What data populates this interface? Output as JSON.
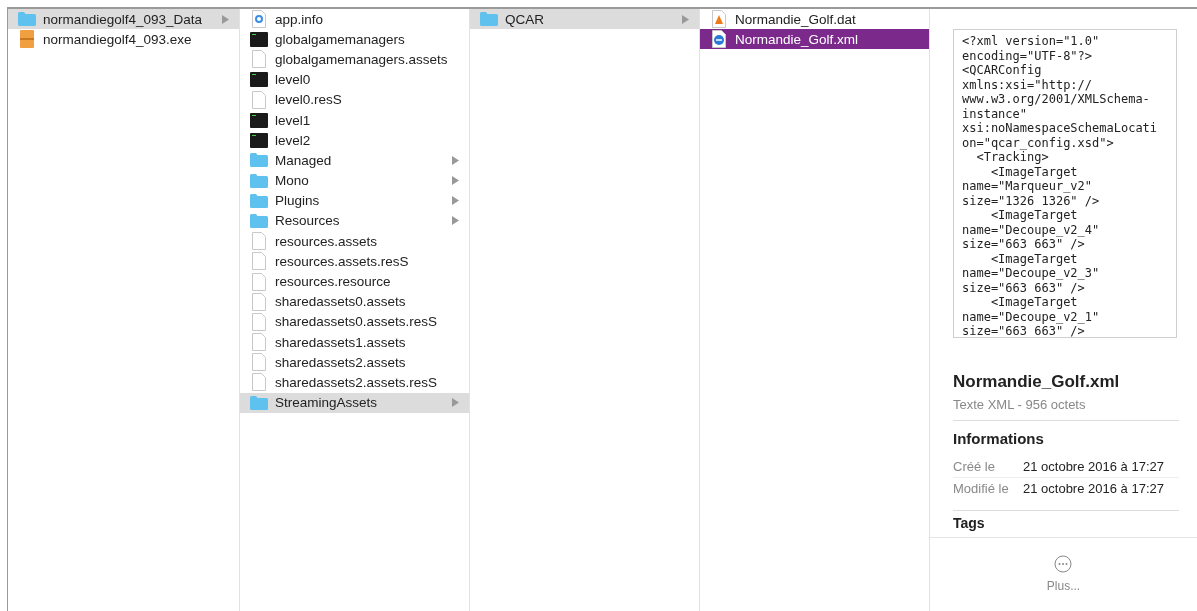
{
  "columns": [
    {
      "focused": false,
      "items": [
        {
          "name": "normandiegolf4_093_Data",
          "kind": "folder",
          "selected": true
        },
        {
          "name": "normandiegolf4_093.exe",
          "kind": "exe",
          "selected": false
        }
      ]
    },
    {
      "focused": false,
      "items": [
        {
          "name": "app.info",
          "kind": "info",
          "selected": false
        },
        {
          "name": "globalgamemanagers",
          "kind": "binary",
          "selected": false
        },
        {
          "name": "globalgamemanagers.assets",
          "kind": "file",
          "selected": false
        },
        {
          "name": "level0",
          "kind": "binary",
          "selected": false
        },
        {
          "name": "level0.resS",
          "kind": "file",
          "selected": false
        },
        {
          "name": "level1",
          "kind": "binary",
          "selected": false
        },
        {
          "name": "level2",
          "kind": "binary",
          "selected": false
        },
        {
          "name": "Managed",
          "kind": "folder",
          "selected": false
        },
        {
          "name": "Mono",
          "kind": "folder",
          "selected": false
        },
        {
          "name": "Plugins",
          "kind": "folder",
          "selected": false
        },
        {
          "name": "Resources",
          "kind": "folder",
          "selected": false
        },
        {
          "name": "resources.assets",
          "kind": "file",
          "selected": false
        },
        {
          "name": "resources.assets.resS",
          "kind": "file",
          "selected": false
        },
        {
          "name": "resources.resource",
          "kind": "file",
          "selected": false
        },
        {
          "name": "sharedassets0.assets",
          "kind": "file",
          "selected": false
        },
        {
          "name": "sharedassets0.assets.resS",
          "kind": "file",
          "selected": false
        },
        {
          "name": "sharedassets1.assets",
          "kind": "file",
          "selected": false
        },
        {
          "name": "sharedassets2.assets",
          "kind": "file",
          "selected": false
        },
        {
          "name": "sharedassets2.assets.resS",
          "kind": "file",
          "selected": false
        },
        {
          "name": "StreamingAssets",
          "kind": "folder",
          "selected": true
        }
      ]
    },
    {
      "focused": false,
      "items": [
        {
          "name": "QCAR",
          "kind": "folder",
          "selected": true
        }
      ]
    },
    {
      "focused": true,
      "items": [
        {
          "name": "Normandie_Golf.dat",
          "kind": "dat",
          "selected": false
        },
        {
          "name": "Normandie_Golf.xml",
          "kind": "xml",
          "selected": true
        }
      ]
    }
  ],
  "preview": {
    "text": "<?xml version=\"1.0\"\nencoding=\"UTF-8\"?>\n<QCARConfig\nxmlns:xsi=\"http://\nwww.w3.org/2001/XMLSchema-\ninstance\"\nxsi:noNamespaceSchemaLocati\non=\"qcar_config.xsd\">\n  <Tracking>\n    <ImageTarget\nname=\"Marqueur_v2\"\nsize=\"1326 1326\" />\n    <ImageTarget\nname=\"Decoupe_v2_4\"\nsize=\"663 663\" />\n    <ImageTarget\nname=\"Decoupe_v2_3\"\nsize=\"663 663\" />\n    <ImageTarget\nname=\"Decoupe_v2_1\"\nsize=\"663 663\" />",
    "title": "Normandie_Golf.xml",
    "subtitle": "Texte XML - 956 octets",
    "info_heading": "Informations",
    "info": [
      {
        "label": "Créé le",
        "value": "21 octobre 2016 à 17:27"
      },
      {
        "label": "Modifié le",
        "value": "21 octobre 2016 à 17:27"
      }
    ],
    "tags_heading": "Tags",
    "more": "Plus..."
  }
}
